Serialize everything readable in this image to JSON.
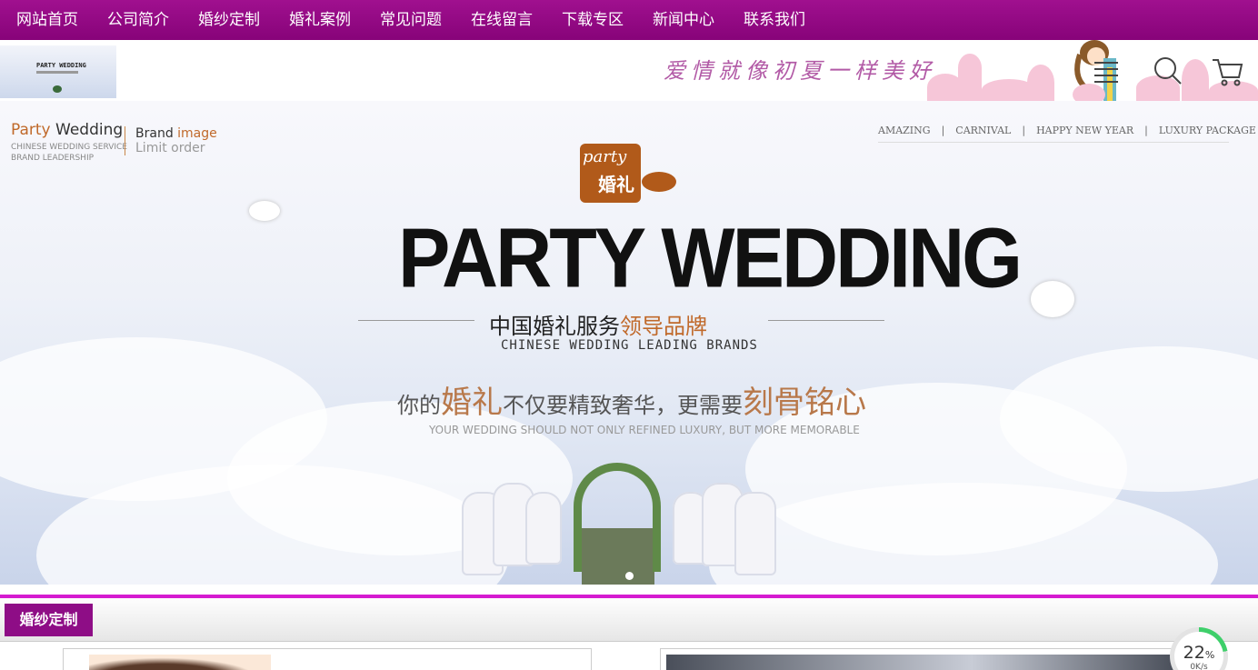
{
  "nav": {
    "items": [
      {
        "label": "网站首页"
      },
      {
        "label": "公司简介"
      },
      {
        "label": "婚纱定制"
      },
      {
        "label": "婚礼案例"
      },
      {
        "label": "常见问题"
      },
      {
        "label": "在线留言"
      },
      {
        "label": "下载专区"
      },
      {
        "label": "新闻中心"
      },
      {
        "label": "联系我们"
      }
    ]
  },
  "header": {
    "slogan": "爱情就像初夏一样美好",
    "icons": [
      "menu-icon",
      "search-icon",
      "cart-icon"
    ]
  },
  "banner": {
    "logo_party": "Party",
    "logo_wedding": " Wedding",
    "logo_sub1": "CHINESE WEDDING SERVICE",
    "logo_sub2": "BRAND LEADERSHIP",
    "brand_prefix": "Brand ",
    "brand_highlight": "image",
    "limit_order": "Limit order",
    "top_links": [
      "AMAZING",
      "CARNIVAL",
      "HAPPY NEW YEAR",
      "LUXURY PACKAGE"
    ],
    "badge_script": "party",
    "badge_cn": "婚礼",
    "hero_title": "PARTY WEDDING",
    "cn_title_pre": "中国婚礼服务",
    "cn_title_hl": "领导品牌",
    "en_title": "CHINESE WEDDING LEADING BRANDS",
    "tagline_1": "你的",
    "tagline_2": "婚礼",
    "tagline_3": "不仅要精致奢华，更需要",
    "tagline_4": "刻骨铭心",
    "tagline_en": "YOUR WEDDING SHOULD NOT ONLY REFINED LUXURY, BUT MORE MEMORABLE"
  },
  "section": {
    "title": "婚纱定制"
  },
  "widget": {
    "progress": 22,
    "unit": "%",
    "net": "0K/s"
  },
  "colors": {
    "nav_bg": "#a0108f",
    "accent": "#d51bd0",
    "brand_orange": "#c0692a",
    "section_btn": "#8e0d86",
    "gauge": "#3ecf6a"
  }
}
